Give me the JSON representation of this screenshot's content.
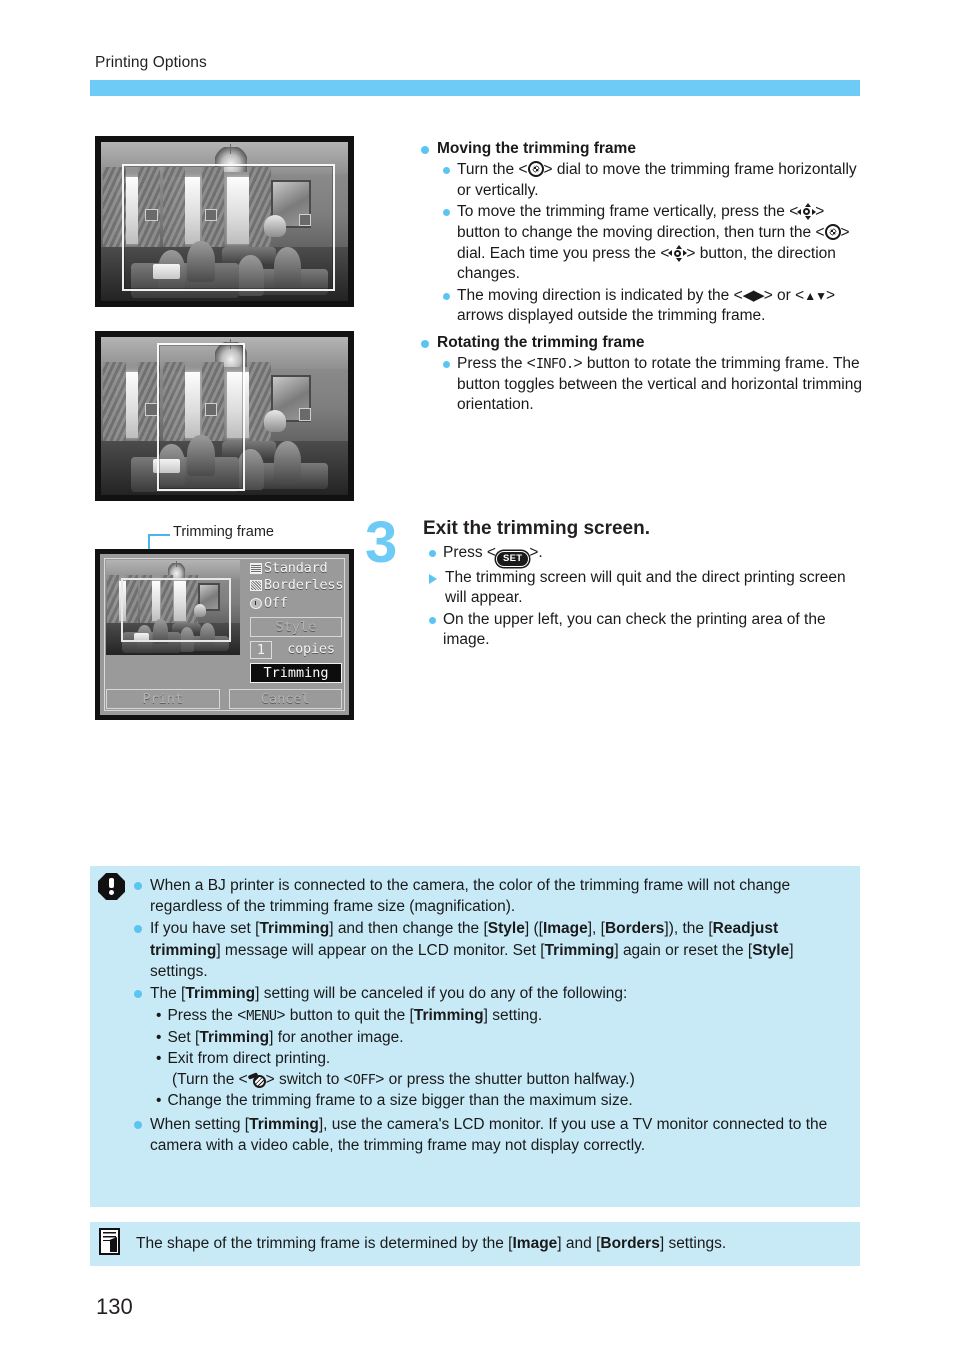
{
  "header": {
    "chapter_title": "Printing Options",
    "rule_color": "#6ecbf5"
  },
  "figures": {
    "photo_top": {
      "alt": "Camera image with horizontal trimming frame"
    },
    "photo_middle": {
      "alt": "Camera image with vertical trimming frame"
    },
    "caption": "Trimming frame",
    "lcd": {
      "menu_standard": "Standard",
      "menu_borderless": "Borderless",
      "menu_off": "Off",
      "btn_style": "Style",
      "copies_count": "1",
      "copies_label": "copies",
      "btn_trimming": "Trimming",
      "btn_print": "Print",
      "btn_cancel": "Cancel"
    }
  },
  "body": {
    "section_move": {
      "heading": "Moving the trimming frame",
      "b1_pre": "Turn the <",
      "b1_post": "> dial to move the trimming frame horizontally or vertically.",
      "b2_pre": "To move the trimming frame vertically, press the <",
      "b2_mid": "> button to change the moving direction, then turn the <",
      "b2_mid2": "> dial. Each time you press the <",
      "b2_post": "> button, the direction changes.",
      "b3_pre": "The moving direction is indicated by the <",
      "b3_arrows_lr": "◀▶",
      "b3_mid": "> or <",
      "b3_arrows_ud": "▲▼",
      "b3_post": "> arrows displayed outside the trimming frame."
    },
    "section_rotate": {
      "heading": "Rotating the trimming frame",
      "b1_pre": "Press the <",
      "b1_btn": "INFO.",
      "b1_post": "> button to rotate the trimming frame. The button toggles between the vertical and horizontal trimming orientation."
    }
  },
  "step3": {
    "number": "3",
    "title": "Exit the trimming screen.",
    "b1_pre": "Press <",
    "b1_btn": "SET",
    "b1_post": ">.",
    "b2": "The trimming screen will quit and the direct printing screen will appear.",
    "b3": "On the upper left, you can check the printing area of the image."
  },
  "caution": {
    "bg_color": "#c8eaf7",
    "item1": "When a BJ printer is connected to the camera, the color of the trimming frame will not change regardless of the trimming frame size (magnification).",
    "item2": {
      "p1": "If you have set [",
      "t1": "Trimming",
      "p2": "] and then change the [",
      "t2": "Style",
      "p3": "] ([",
      "t3": "Image",
      "p4": "], [",
      "t4": "Borders",
      "p5": "]), the [",
      "t5": "Readjust trimming",
      "p6": "] message will appear on the LCD monitor. Set [",
      "t6": "Trimming",
      "p7": "] again or reset the [",
      "t7": "Style",
      "p8": "] settings."
    },
    "item3": {
      "p1": "The [",
      "t1": "Trimming",
      "p2": "] setting will be canceled if you do any of the following:"
    },
    "sub1": {
      "bullet": "•",
      "p1": "Press the <",
      "btn": "MENU",
      "p2": "> button to quit the [",
      "t1": "Trimming",
      "p3": "] setting."
    },
    "sub2": {
      "bullet": "•",
      "p1": "Set [",
      "t1": "Trimming",
      "p2": "] for another image."
    },
    "sub3": {
      "bullet": "•",
      "p1": "Exit from direct printing."
    },
    "sub3b": {
      "p1": "(Turn the <",
      "p2": "> switch to <",
      "btn": "OFF",
      "p3": "> or press the shutter button halfway.)"
    },
    "sub4": {
      "bullet": "•",
      "p1": "Change the trimming frame to a size bigger than the maximum size."
    },
    "item4": {
      "p1": "When setting [",
      "t1": "Trimming",
      "p2": "], use the camera's LCD monitor. If you use a TV monitor connected to the camera with a video cable, the trimming frame may not display correctly."
    }
  },
  "note": {
    "bg_color": "#c8eaf7",
    "p1": "The shape of the trimming frame is determined by the [",
    "t1": "Image",
    "p2": "] and [",
    "t2": "Borders",
    "p3": "] settings."
  },
  "footer": {
    "page_number": "130"
  }
}
